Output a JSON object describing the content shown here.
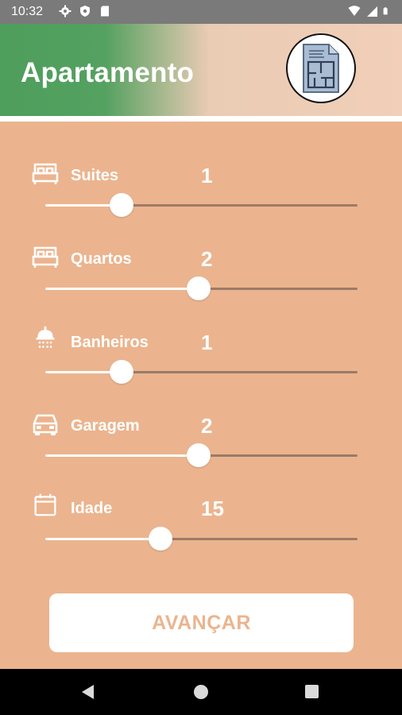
{
  "status_bar": {
    "time": "10:32",
    "left_icons": [
      "gear-icon",
      "shield-icon",
      "sd-card-icon"
    ],
    "right_icons": [
      "wifi-icon",
      "signal-icon",
      "battery-icon"
    ]
  },
  "header": {
    "title": "Apartamento",
    "logo_icon": "floor-plan-icon",
    "gradient_colors": [
      "#4E9E5C",
      "#F1CFB8"
    ]
  },
  "colors": {
    "background": "#EBB48E",
    "accent_text": "#FFFFFF",
    "track": "#9C7B68"
  },
  "fields": [
    {
      "label": "Suites",
      "value": "1",
      "icon": "bed-icon",
      "slider_fraction": 0.244
    },
    {
      "label": "Quartos",
      "value": "2",
      "icon": "bed-icon",
      "slider_fraction": 0.492
    },
    {
      "label": "Banheiros",
      "value": "1",
      "icon": "shower-icon",
      "slider_fraction": 0.244
    },
    {
      "label": "Garagem",
      "value": "2",
      "icon": "car-icon",
      "slider_fraction": 0.492
    },
    {
      "label": "Idade",
      "value": "15",
      "icon": "calendar-icon",
      "slider_fraction": 0.369
    }
  ],
  "button": {
    "label": "AVANÇAR"
  },
  "nav": {
    "items": [
      "back-icon",
      "home-icon",
      "recent-apps-icon"
    ]
  }
}
